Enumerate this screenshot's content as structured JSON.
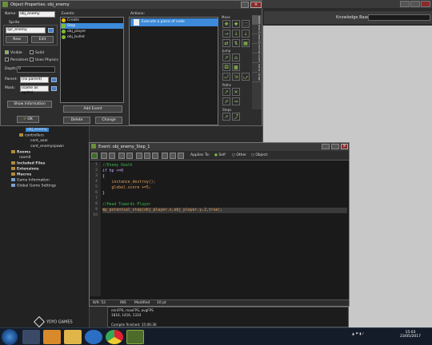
{
  "ide": {
    "knowledge_base_label": "Knowledge Base"
  },
  "resource_tree": {
    "items": [
      {
        "label": "obj_enemy",
        "selected": true
      },
      {
        "label": "controllers"
      },
      {
        "label": "cont_xoar"
      },
      {
        "label": "cont_enemyspawn"
      },
      {
        "label": "Rooms",
        "bold": true
      },
      {
        "label": "room0"
      },
      {
        "label": "Included Files",
        "bold": true
      },
      {
        "label": "Extensions",
        "bold": true
      },
      {
        "label": "Macros",
        "bold": true
      },
      {
        "label": "Game Information"
      },
      {
        "label": "Global Game Settings"
      }
    ]
  },
  "object_properties": {
    "title": "Object Properties: obj_enemy",
    "name_label": "Name:",
    "name_value": "obj_enemy",
    "sprite_label": "Sprite",
    "sprite_value": "spr_enemy",
    "new_button": "New",
    "edit_button": "Edit",
    "visible_label": "Visible",
    "solid_label": "Solid",
    "persistent_label": "Persistent",
    "uses_physics_label": "Uses Physics",
    "depth_label": "Depth:",
    "depth_value": "0",
    "parent_label": "Parent:",
    "parent_value": "(no parent)",
    "mask_label": "Mask:",
    "mask_value": "(same as sprite)",
    "show_info_button": "Show Information",
    "ok_button": "OK",
    "events_label": "Events:",
    "events": [
      {
        "label": "Create",
        "selected": false,
        "icon_color": "#e6c200"
      },
      {
        "label": "Step",
        "selected": true,
        "icon_color": "#e6c200"
      },
      {
        "label": "obj_player",
        "selected": false,
        "icon_color": "#e6c200"
      },
      {
        "label": "obj_bullet",
        "selected": false,
        "icon_color": "#e6c200"
      }
    ],
    "add_event_button": "Add Event",
    "delete_button": "Delete",
    "change_button": "Change",
    "actions_label": "Actions:",
    "actions": [
      {
        "label": "Execute a piece of code"
      }
    ],
    "palette": {
      "move_label": "Move",
      "jump_label": "Jump",
      "paths_label": "Paths",
      "steps_label": "Steps",
      "tabs": [
        "move",
        "main1",
        "main2",
        "control",
        "score",
        "extra",
        "draw"
      ]
    }
  },
  "code_editor": {
    "title": "Event: obj_enemy_Step_1",
    "applies_to_label": "Applies To:",
    "self_label": "Self",
    "other_label": "Other",
    "object_label": "Object:",
    "line_numbers": [
      "1",
      "2",
      "3",
      "4",
      "5",
      "6",
      "7",
      "8",
      "9",
      "10"
    ],
    "lines": [
      {
        "text": "//Enemy Death",
        "color": "#3cb44b"
      },
      {
        "text": "if hp <=0",
        "color": "#c8a8ff"
      },
      {
        "text": "{",
        "color": "#dddddd"
      },
      {
        "text": "    instance_destroy();",
        "color": "#e8a05a"
      },
      {
        "text": "    global.score +=5;",
        "color": "#e8a05a"
      },
      {
        "text": "}",
        "color": "#dddddd"
      },
      {
        "text": "",
        "color": "#dddddd"
      },
      {
        "text": "//Head Towards Player",
        "color": "#3cb44b"
      },
      {
        "text": "mp_potential_step(obj_player.x,obj_player.y,2,true);",
        "color": "#e8a05a",
        "highlight": true
      },
      {
        "text": "",
        "color": "#dddddd"
      }
    ],
    "status_pos": "8/9: 53",
    "status_ins": "INS",
    "status_modified": "Modified",
    "status_size": "10 pt"
  },
  "output": {
    "lines": [
      "minFPS, maxFPS, avgFPS",
      "1816, 1416, 1324",
      "",
      "Compile finished: 15:06:36"
    ]
  },
  "yoyo_logo_text": "YOYO GAMES",
  "taskbar": {
    "clock_time": "15:03",
    "clock_date": "23/05/2017",
    "apps": [
      "explorer",
      "media-player",
      "file-explorer",
      "internet-explorer",
      "chrome",
      "gamemaker"
    ]
  }
}
